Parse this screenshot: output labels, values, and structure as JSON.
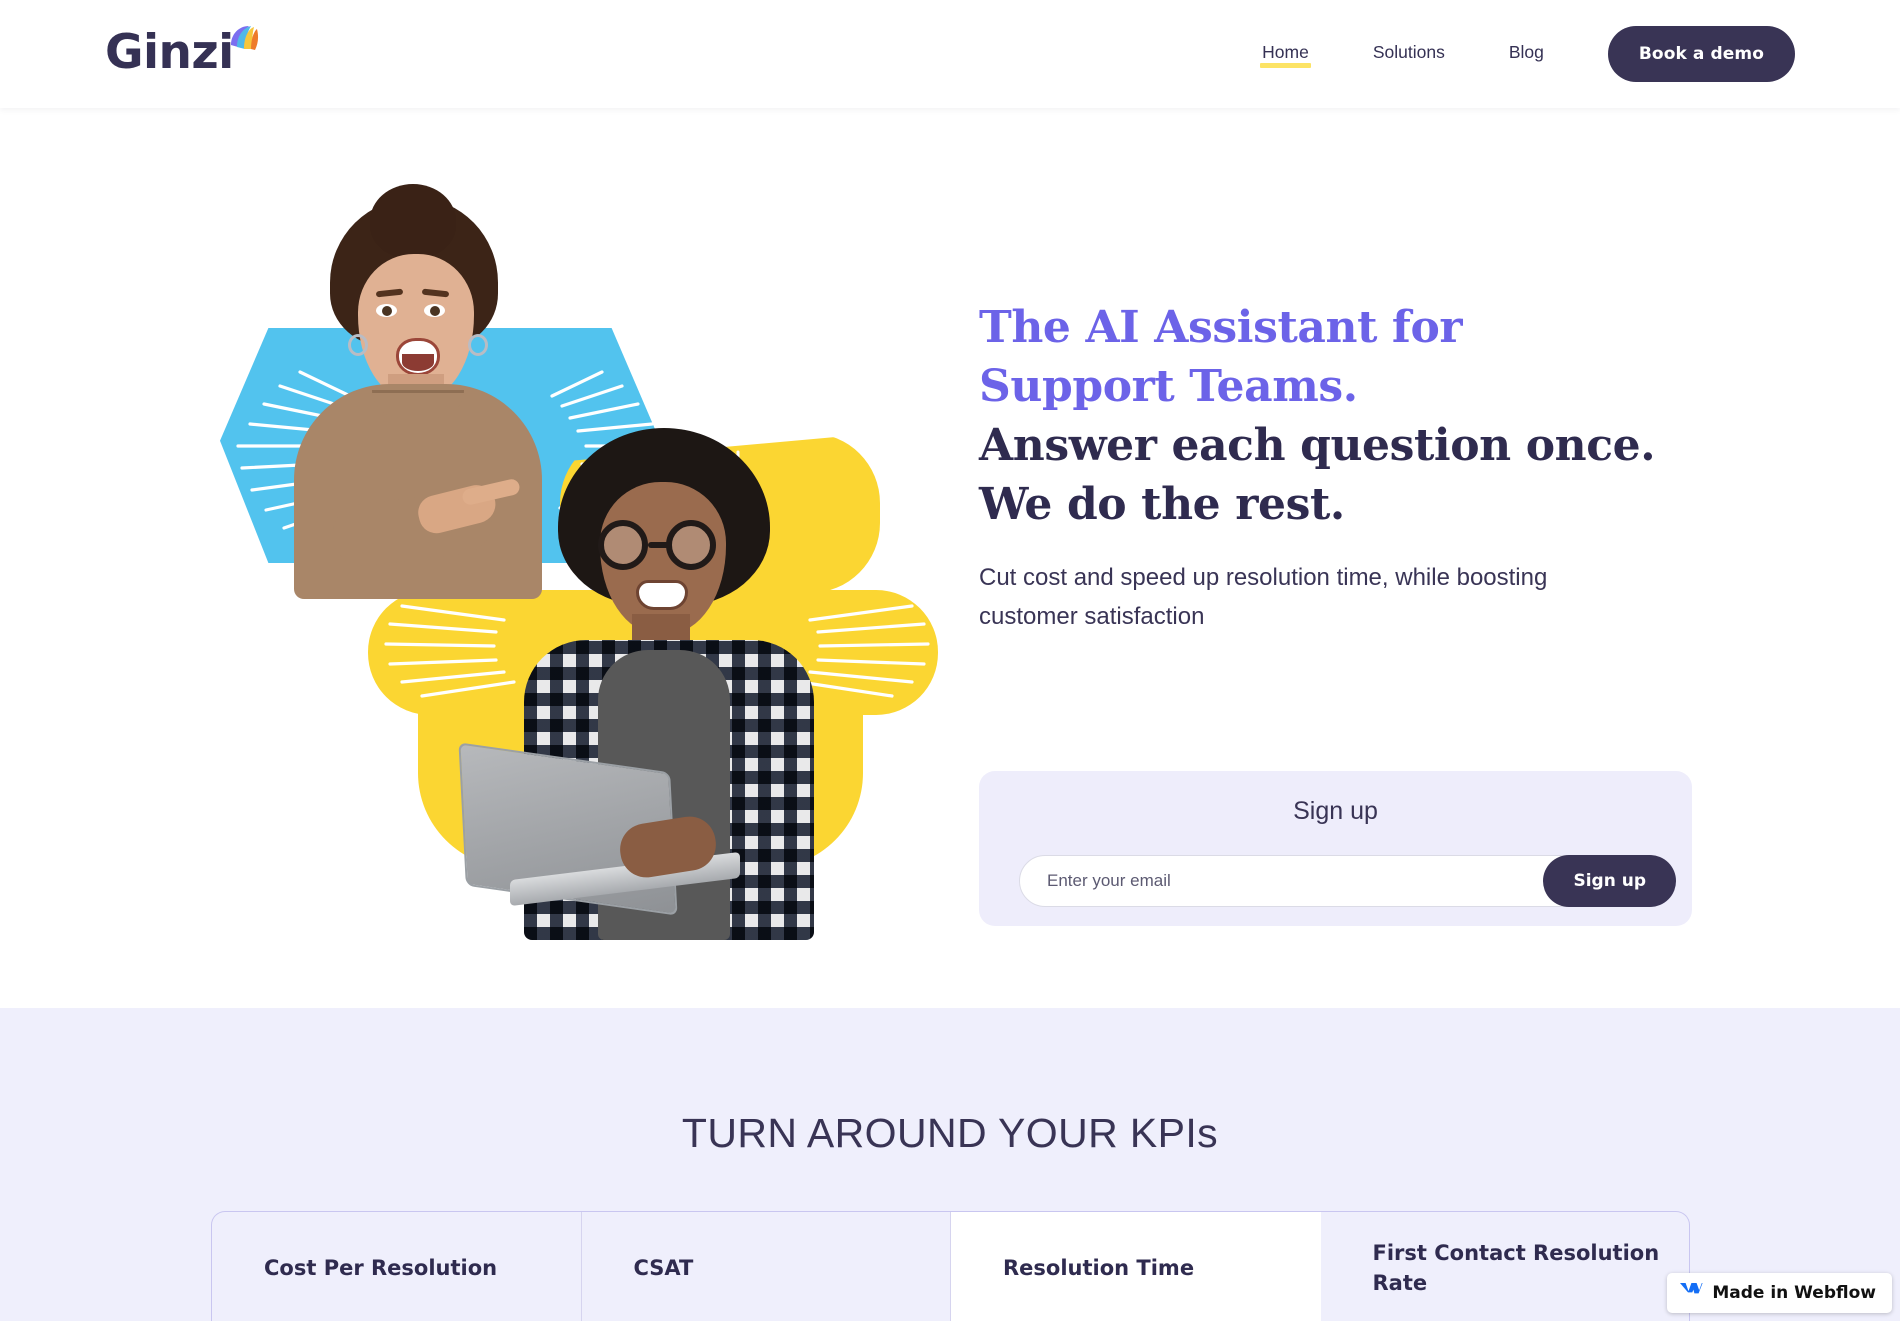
{
  "brand": {
    "name": "Ginzi",
    "mark_colors": [
      "#7B6EF0",
      "#4FB8E8",
      "#F6C63C",
      "#EE7B2B"
    ]
  },
  "nav": {
    "items": [
      {
        "label": "Home",
        "active": true
      },
      {
        "label": "Solutions",
        "active": false
      },
      {
        "label": "Blog",
        "active": false
      }
    ],
    "cta_label": "Book a demo"
  },
  "hero": {
    "title_accent_line1": "The AI Assistant for",
    "title_accent_line2": "Support Teams.",
    "title_dark_line1": "Answer each question once.",
    "title_dark_line2": "We do the rest.",
    "subtitle": "Cut cost and speed up resolution time, while boosting customer satisfaction",
    "accent_color": "#6C63E8",
    "dark_color": "#2F2B4F"
  },
  "signup": {
    "title": "Sign up",
    "placeholder": "Enter your email",
    "value": "",
    "button_label": "Sign up"
  },
  "kpi": {
    "heading_main": "TURN AROUND YOUR KPI",
    "heading_suffix": "s",
    "tabs": [
      {
        "label": "Cost Per Resolution",
        "active": false
      },
      {
        "label": "CSAT",
        "active": false
      },
      {
        "label": "Resolution Time",
        "active": true
      },
      {
        "label": "First Contact Resolution Rate",
        "active": false
      }
    ],
    "background": "#EFEFFC"
  },
  "webflow_badge": {
    "label": "Made in Webflow",
    "logo_color": "#146EF5"
  }
}
